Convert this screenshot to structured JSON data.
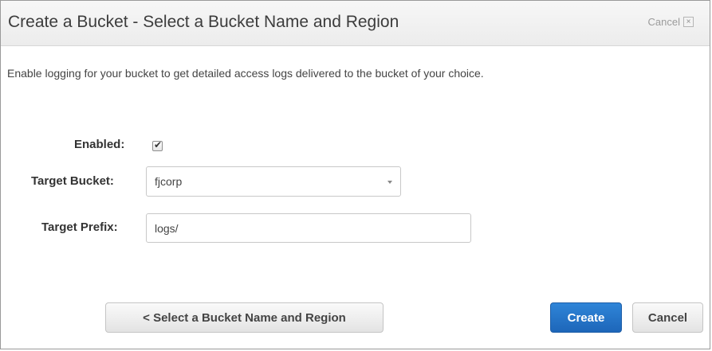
{
  "dialog": {
    "title": "Create a Bucket - Select a Bucket Name and Region",
    "close_label": "Cancel",
    "close_icon": "close-icon"
  },
  "description": "Enable logging for your bucket to get detailed access logs delivered to the bucket of your choice.",
  "form": {
    "enabled_label": "Enabled:",
    "enabled_checked": true,
    "target_bucket_label": "Target Bucket:",
    "target_bucket_value": "fjcorp",
    "target_prefix_label": "Target Prefix:",
    "target_prefix_value": "logs/"
  },
  "buttons": {
    "back_label": "< Select a Bucket Name and Region",
    "create_label": "Create",
    "cancel_label": "Cancel"
  },
  "colors": {
    "primary": "#1d66b9",
    "header_bg": "#ececec"
  }
}
